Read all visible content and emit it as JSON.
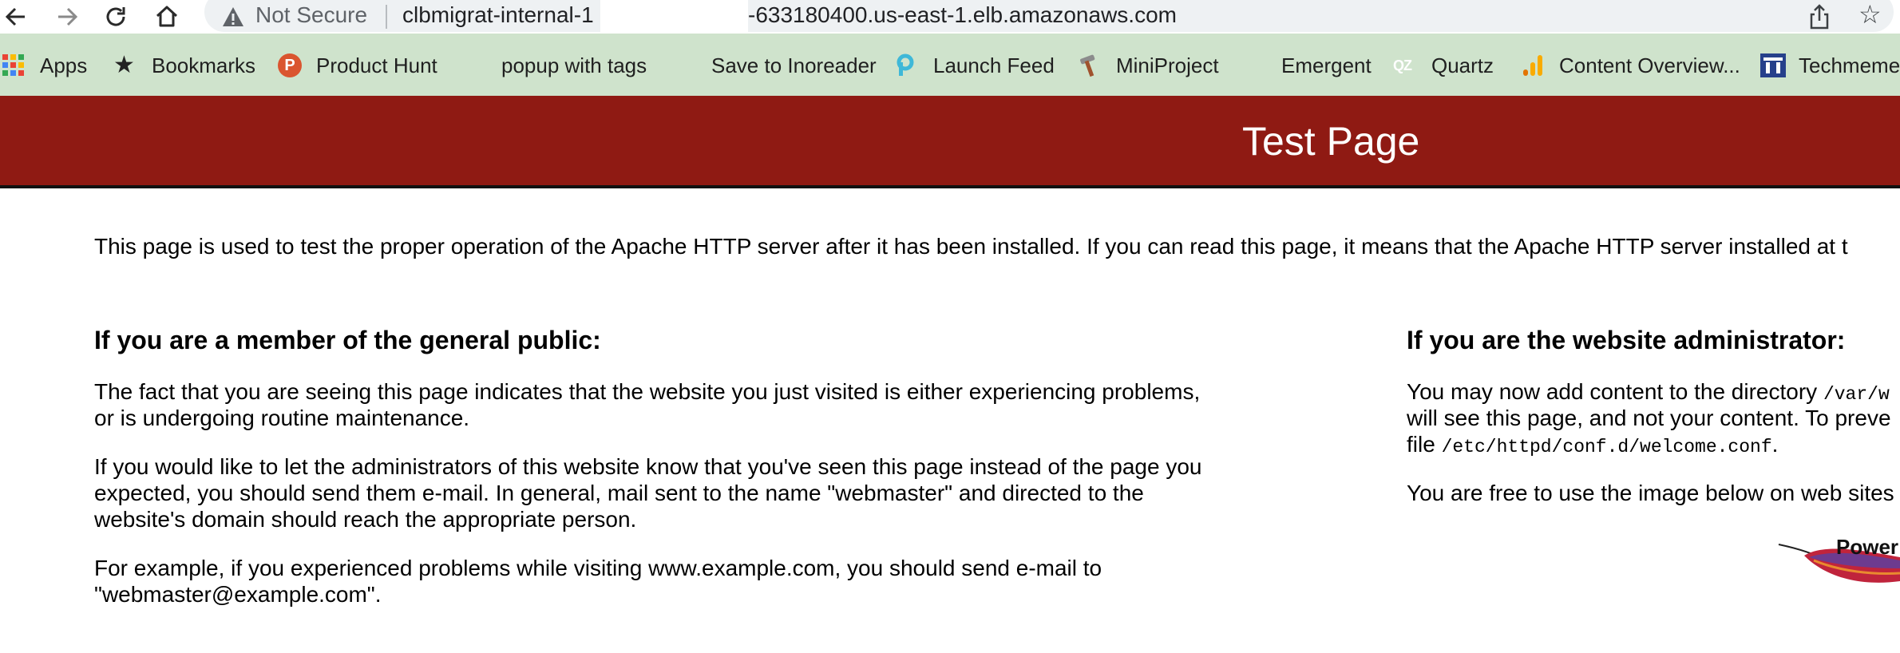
{
  "browser": {
    "security_label": "Not Secure",
    "url_start": "clbmigrat-internal-1",
    "url_end": "-633180400.us-east-1.elb.amazonaws.com"
  },
  "bookmarks": [
    {
      "label": "Apps",
      "icon": "apps-grid-icon"
    },
    {
      "label": "Bookmarks",
      "icon": "star-icon"
    },
    {
      "label": "Product Hunt",
      "icon": "product-hunt-icon"
    },
    {
      "label": "popup with tags",
      "icon": "globe-icon"
    },
    {
      "label": "Save to Inoreader",
      "icon": "globe-icon"
    },
    {
      "label": "Launch Feed",
      "icon": "launch-feed-icon"
    },
    {
      "label": "MiniProject",
      "icon": "hammer-icon"
    },
    {
      "label": "Emergent",
      "icon": "globe-icon"
    },
    {
      "label": "Quartz",
      "icon": "quartz-icon"
    },
    {
      "label": "Content Overview...",
      "icon": "analytics-icon"
    },
    {
      "label": "Techmeme",
      "icon": "techmeme-icon"
    }
  ],
  "colors": {
    "header_bg": "#8f1a13",
    "bookmarks_bg": "#cfe3cc"
  },
  "page": {
    "title": "Test Page",
    "intro": "This page is used to test the proper operation of the Apache HTTP server after it has been installed. If you can read this page, it means that the Apache HTTP server installed at t",
    "public": {
      "heading": "If you are a member of the general public:",
      "p1_line1": "The fact that you are seeing this page indicates that the website you just visited is either experiencing problems,",
      "p1_line2": "or is undergoing routine maintenance.",
      "p2_line1": "If you would like to let the administrators of this website know that you've seen this page instead of the page you",
      "p2_line2": "expected, you should send them e-mail. In general, mail sent to the name \"webmaster\" and directed to the",
      "p2_line3": "website's domain should reach the appropriate person.",
      "p3_line1": "For example, if you experienced problems while visiting www.example.com, you should send e-mail to",
      "p3_line2": "\"webmaster@example.com\"."
    },
    "admin": {
      "heading": "If you are the website administrator:",
      "p1_line1_text": "You may now add content to the directory ",
      "p1_line1_code": "/var/w",
      "p1_line2": "will see this page, and not your content. To preve",
      "p1_line3_text": "file ",
      "p1_line3_code": "/etc/httpd/conf.d/welcome.conf",
      "p1_line3_end": ".",
      "p2": "You are free to use the image below on web sites",
      "badge_text": "Power"
    }
  }
}
